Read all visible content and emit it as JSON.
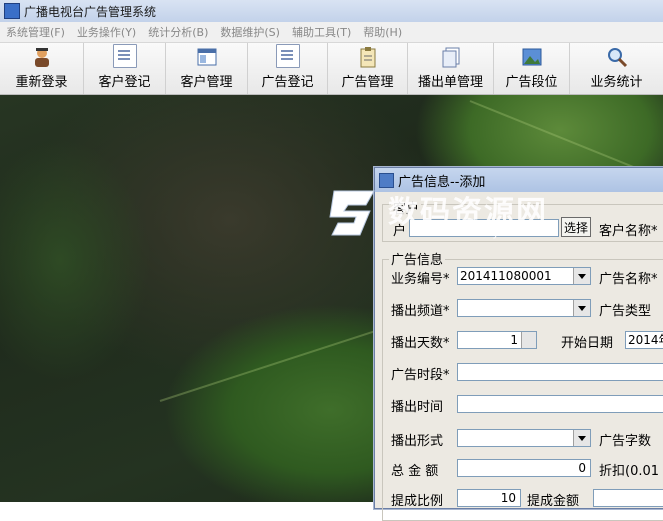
{
  "window": {
    "title": "广播电视台广告管理系统"
  },
  "menu": [
    "系统管理(F)",
    "业务操作(Y)",
    "统计分析(B)",
    "数据维护(S)",
    "辅助工具(T)",
    "帮助(H)"
  ],
  "toolbar": [
    {
      "label": "重新登录",
      "icon": "user-login-icon"
    },
    {
      "label": "客户登记",
      "icon": "document-icon"
    },
    {
      "label": "客户管理",
      "icon": "window-icon"
    },
    {
      "label": "广告登记",
      "icon": "document-icon"
    },
    {
      "label": "广告管理",
      "icon": "clipboard-icon"
    },
    {
      "label": "播出单管理",
      "icon": "documents-icon"
    },
    {
      "label": "广告段位",
      "icon": "picture-icon"
    },
    {
      "label": "业务统计",
      "icon": "magnifier-icon"
    }
  ],
  "dialog": {
    "title": "广告信息--添加",
    "customer_group": "客户",
    "customer_label": "户",
    "select_button": "选择",
    "customer_name_label": "客户名称*",
    "ad_group": "广告信息",
    "business_no_label": "业务编号*",
    "business_no_value": "201411080001",
    "ad_name_label": "广告名称*",
    "channel_label": "播出频道*",
    "ad_type_label": "广告类型",
    "days_label": "播出天数*",
    "days_value": "1",
    "start_date_label": "开始日期",
    "start_date_value": "2014年",
    "slot_label": "广告时段*",
    "time_label": "播出时间",
    "form_label": "播出形式",
    "word_count_label": "广告字数",
    "total_label": "总 金 额",
    "total_value": "0",
    "discount_label": "折扣(0.01",
    "commission_ratio_label": "提成比例",
    "commission_ratio_value": "10",
    "commission_amount_label": "提成金额"
  },
  "watermark": {
    "text": "数码资源网",
    "url": "www.smzy.com"
  }
}
